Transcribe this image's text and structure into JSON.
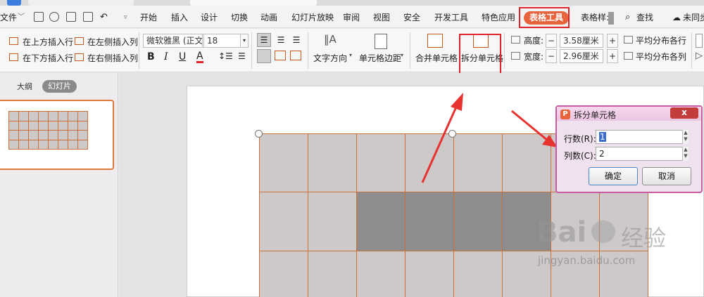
{
  "menu": {
    "file": "文件",
    "items": [
      "开始",
      "插入",
      "设计",
      "切换",
      "动画",
      "幻灯片放映",
      "审阅",
      "视图",
      "安全",
      "开发工具",
      "特色应用"
    ],
    "table_tools": "表格工具",
    "table_style": "表格样:",
    "find": "查找",
    "unsync": "未同步"
  },
  "ribbon": {
    "insert_row_above": "在上方插入行",
    "insert_col_left": "在左侧插入列",
    "insert_row_below": "在下方插入行",
    "insert_col_right": "在右侧插入列",
    "font_name": "微软雅黑 (正文",
    "font_size": "18",
    "bold": "B",
    "italic": "I",
    "underline": "U",
    "font_color": "A",
    "text_direction": "文字方向",
    "cell_margin": "单元格边距",
    "merge_cells": "合并单元格",
    "split_cells": "拆分单元格",
    "height_label": "高度:",
    "height_value": "3.58厘米",
    "width_label": "宽度:",
    "width_value": "2.96厘米",
    "distribute_rows": "平均分布各行",
    "distribute_cols": "平均分布各列",
    "minus": "−",
    "plus": "+"
  },
  "left_panel": {
    "outline_tab": "大纲",
    "slides_tab": "幻灯片"
  },
  "dialog": {
    "title": "拆分单元格",
    "close": "x",
    "rows_label": "行数(R):",
    "rows_value": "1",
    "cols_label": "列数(C):",
    "cols_value": "2",
    "ok": "确定",
    "cancel": "取消"
  },
  "watermark": {
    "brand": "Bai",
    "brand_cn": "经验",
    "url": "jingyan.baidu.com"
  },
  "colors": {
    "accent_orange": "#e8643c",
    "annotation_red": "#e0232a",
    "cell_gray": "#cdc9c9",
    "cell_selected": "#8e8c8c",
    "cell_border": "#c8703c",
    "dialog_border": "#c85aa4"
  }
}
